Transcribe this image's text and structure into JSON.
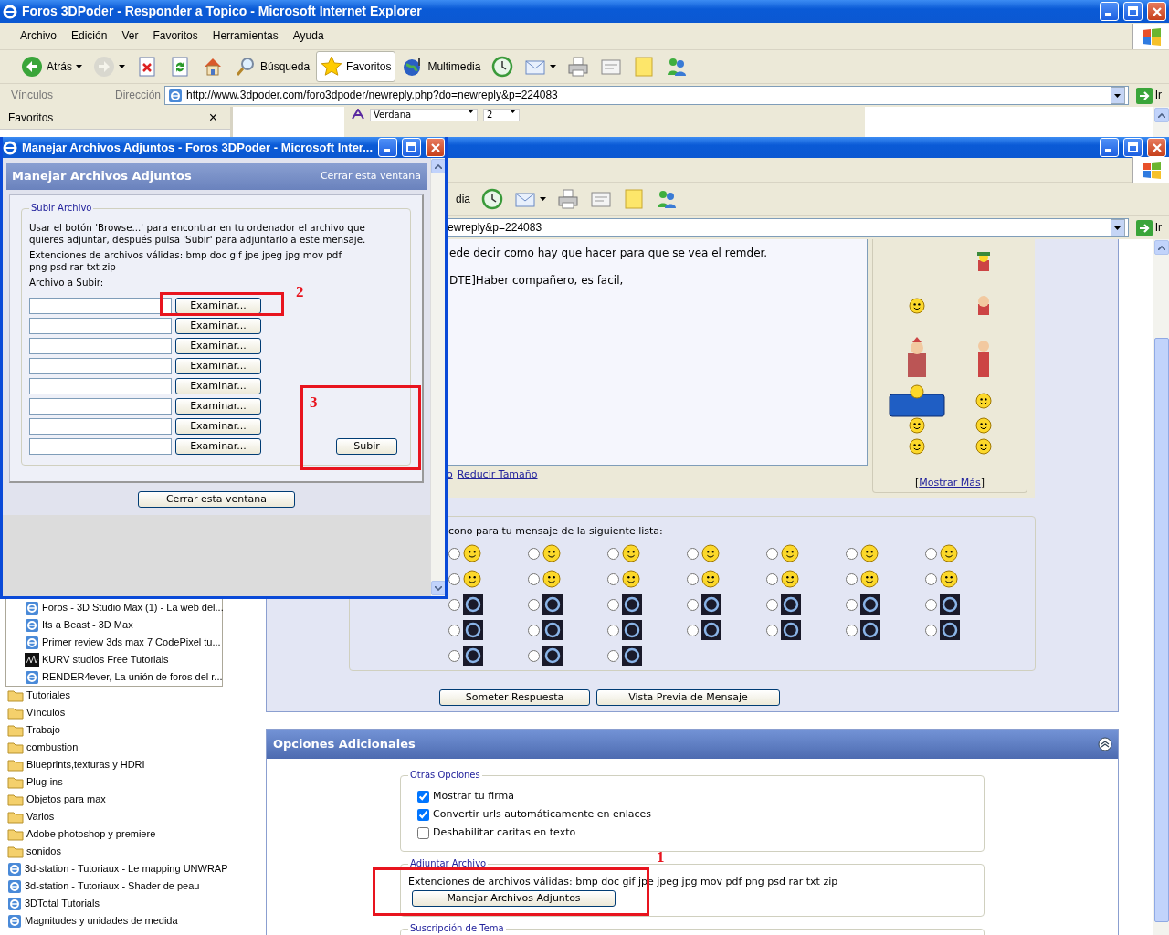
{
  "window": {
    "title": "Foros 3DPoder - Responder a Topico - Microsoft Internet Explorer",
    "menu": [
      "Archivo",
      "Edición",
      "Ver",
      "Favoritos",
      "Herramientas",
      "Ayuda"
    ],
    "toolbar": [
      {
        "kind": "back",
        "label": "Atrás",
        "dropdown": true,
        "pressed": false,
        "disabled": false
      },
      {
        "kind": "forward",
        "dropdown": true,
        "pressed": false,
        "disabled": true
      },
      {
        "kind": "stop",
        "dropdown": false,
        "pressed": false,
        "disabled": false
      },
      {
        "kind": "refresh",
        "dropdown": false,
        "pressed": false,
        "disabled": false
      },
      {
        "kind": "home",
        "dropdown": false,
        "pressed": false,
        "disabled": false
      },
      {
        "kind": "search",
        "label": "Búsqueda",
        "dropdown": false,
        "pressed": false,
        "disabled": false
      },
      {
        "kind": "favorites",
        "label": "Favoritos",
        "dropdown": false,
        "pressed": true,
        "disabled": false
      },
      {
        "kind": "media",
        "label": "Multimedia",
        "dropdown": false,
        "pressed": false,
        "disabled": false
      },
      {
        "kind": "history",
        "dropdown": false,
        "pressed": false,
        "disabled": false
      },
      {
        "kind": "mail",
        "dropdown": true,
        "pressed": false,
        "disabled": false
      },
      {
        "kind": "print",
        "dropdown": false,
        "pressed": false,
        "disabled": false
      },
      {
        "kind": "edit",
        "dropdown": false,
        "pressed": false,
        "disabled": false
      },
      {
        "kind": "note",
        "dropdown": false,
        "pressed": false,
        "disabled": false
      },
      {
        "kind": "messenger",
        "dropdown": false,
        "pressed": false,
        "disabled": false
      }
    ],
    "links_label": "Vínculos",
    "address_label": "Dirección",
    "address": "http://www.3dpoder.com/foro3dpoder/newreply.php?do=newreply&p=224083",
    "go": "Ir"
  },
  "favorites_pane": {
    "title": "Favoritos",
    "close": "×",
    "group_items": [
      {
        "kind": "page",
        "label": "Foros - 3D Studio Max (1) - La web del..."
      },
      {
        "kind": "page",
        "label": "Its a Beast - 3D Max"
      },
      {
        "kind": "page",
        "label": "Primer review 3ds max 7  CodePixel  tu..."
      },
      {
        "kind": "site-logo",
        "label": "KURV studios  Free Tutorials"
      },
      {
        "kind": "page",
        "label": "RENDER4ever, La unión de foros del r..."
      }
    ],
    "items": [
      {
        "kind": "folder",
        "label": "Tutoriales"
      },
      {
        "kind": "folder",
        "label": "Vínculos"
      },
      {
        "kind": "folder",
        "label": "Trabajo"
      },
      {
        "kind": "folder",
        "label": "combustion"
      },
      {
        "kind": "folder",
        "label": "Blueprints,texturas y HDRI"
      },
      {
        "kind": "folder",
        "label": "Plug-ins"
      },
      {
        "kind": "folder",
        "label": "Objetos para max"
      },
      {
        "kind": "folder",
        "label": "Varios"
      },
      {
        "kind": "folder",
        "label": "Adobe photoshop y premiere"
      },
      {
        "kind": "folder",
        "label": "sonidos"
      },
      {
        "kind": "page",
        "label": "3d-station - Tutoriaux - Le mapping UNWRAP"
      },
      {
        "kind": "page",
        "label": "3d-station - Tutoriaux - Shader de peau"
      },
      {
        "kind": "page",
        "label": "3DTotal Tutorials"
      },
      {
        "kind": "page",
        "label": "Magnitudes y unidades de medida"
      }
    ]
  },
  "editor_toolbar": {
    "font": "Verdana",
    "size": "2"
  },
  "second_window": {
    "toolbar": [
      {
        "kind": "text",
        "label": "dia",
        "dropdown": false,
        "pressed": false,
        "disabled": false
      },
      {
        "kind": "history",
        "dropdown": false,
        "pressed": false,
        "disabled": false
      },
      {
        "kind": "mail",
        "dropdown": true,
        "pressed": false,
        "disabled": false
      },
      {
        "kind": "print",
        "dropdown": false,
        "pressed": false,
        "disabled": false
      },
      {
        "kind": "edit",
        "dropdown": false,
        "pressed": false,
        "disabled": false
      },
      {
        "kind": "note",
        "dropdown": false,
        "pressed": false,
        "disabled": false
      },
      {
        "kind": "messenger",
        "dropdown": false,
        "pressed": false,
        "disabled": false
      }
    ],
    "address": "ewreply&p=224083",
    "go": "Ir"
  },
  "post": {
    "lines": [
      "ede decir como hay que hacer para que se vea el remder.",
      "DTE]Haber compañero, es facil,"
    ],
    "links": [
      "o",
      "Reducir Tamaño"
    ],
    "more_smilies": {
      "open": "[",
      "link": "Mostrar Más",
      "close": "]"
    }
  },
  "message_icons": {
    "legend": "cono para tu mensaje de la siguiente lista:",
    "icons": [
      {
        "kind": "smiley",
        "selected": false
      },
      {
        "kind": "smiley",
        "selected": false
      },
      {
        "kind": "smiley",
        "selected": false
      },
      {
        "kind": "smiley",
        "selected": false
      },
      {
        "kind": "smiley",
        "selected": false
      },
      {
        "kind": "smiley",
        "selected": false
      },
      {
        "kind": "smiley",
        "selected": false
      },
      {
        "kind": "smiley",
        "selected": false
      },
      {
        "kind": "smiley",
        "selected": false
      },
      {
        "kind": "smiley",
        "selected": false
      },
      {
        "kind": "smiley",
        "selected": false
      },
      {
        "kind": "smiley",
        "selected": false
      },
      {
        "kind": "smiley",
        "selected": false
      },
      {
        "kind": "smiley",
        "selected": false
      },
      {
        "kind": "logo",
        "selected": false
      },
      {
        "kind": "logo",
        "selected": false
      },
      {
        "kind": "logo",
        "selected": false
      },
      {
        "kind": "logo",
        "selected": false
      },
      {
        "kind": "logo",
        "selected": false
      },
      {
        "kind": "logo",
        "selected": false
      },
      {
        "kind": "logo",
        "selected": false
      },
      {
        "kind": "logo",
        "selected": false
      },
      {
        "kind": "logo",
        "selected": false
      },
      {
        "kind": "logo",
        "selected": false
      },
      {
        "kind": "logo",
        "selected": false
      },
      {
        "kind": "logo",
        "selected": false
      },
      {
        "kind": "logo",
        "selected": false
      },
      {
        "kind": "logo",
        "selected": false
      },
      {
        "kind": "logo",
        "selected": false
      },
      {
        "kind": "logo",
        "selected": false
      },
      {
        "kind": "logo",
        "selected": false
      }
    ]
  },
  "buttons": [
    "Someter Respuesta",
    "Vista Previa de Mensaje"
  ],
  "options_panel": {
    "title": "Opciones Adicionales",
    "other_options": {
      "legend": "Otras Opciones",
      "checks": [
        {
          "label": "Mostrar tu firma",
          "checked": true
        },
        {
          "label": "Convertir urls automáticamente en enlaces",
          "checked": true
        },
        {
          "label": "Deshabilitar caritas en texto",
          "checked": false
        }
      ]
    },
    "attach": {
      "legend": "Adjuntar Archivo",
      "extensions": "Extenciones de archivos válidas: bmp doc gif jpe jpeg jpg mov pdf png psd rar txt zip",
      "button": "Manejar Archivos Adjuntos"
    },
    "subscription": {
      "legend": "Suscripción de Tema"
    }
  },
  "popup": {
    "title": "Manejar Archivos Adjuntos - Foros 3DPoder - Microsoft Inter...",
    "header": "Manejar Archivos Adjuntos",
    "close_link": "Cerrar esta ventana",
    "legend": "Subir Archivo",
    "instructions": "Usar el botón 'Browse...' para encontrar en tu ordenador el archivo que quieres adjuntar, después pulsa 'Subir' para adjuntarlo a este mensaje.",
    "extensions": "Extenciones de archivos válidas: bmp doc gif jpe jpeg jpg mov pdf png psd rar txt zip",
    "file_label": "Archivo a Subir:",
    "file_rows": [
      {
        "button": "Examinar..."
      },
      {
        "button": "Examinar..."
      },
      {
        "button": "Examinar..."
      },
      {
        "button": "Examinar..."
      },
      {
        "button": "Examinar..."
      },
      {
        "button": "Examinar..."
      },
      {
        "button": "Examinar..."
      },
      {
        "button": "Examinar..."
      }
    ],
    "upload": "Subir",
    "close_button": "Cerrar esta ventana"
  },
  "annotations": [
    {
      "label": "1"
    },
    {
      "label": "2"
    },
    {
      "label": "3"
    }
  ]
}
